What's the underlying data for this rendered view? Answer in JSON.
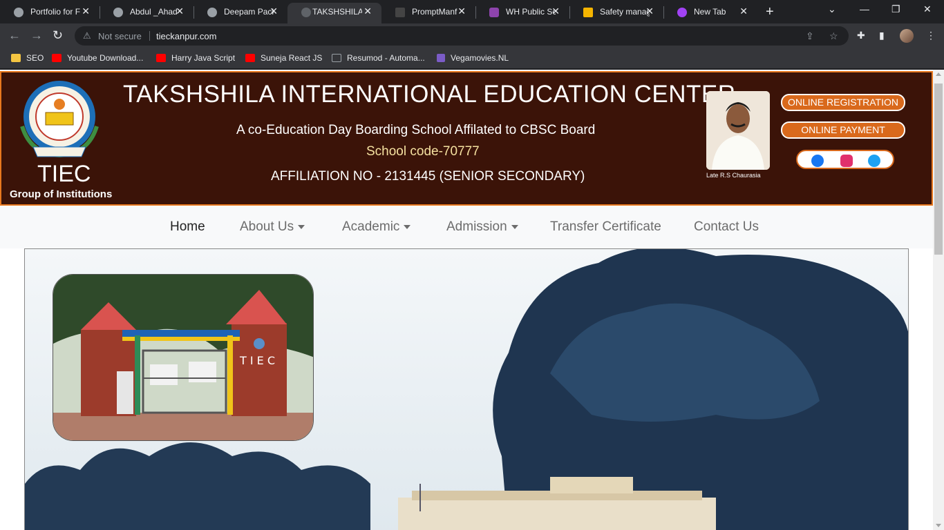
{
  "browser": {
    "tabs": [
      {
        "title": "Portfolio for F",
        "active": false
      },
      {
        "title": "Abdul _Ahad",
        "active": false
      },
      {
        "title": "Deepam Pack",
        "active": false
      },
      {
        "title": "TAKSHSHILA I",
        "active": true
      },
      {
        "title": "PromptManf",
        "active": false
      },
      {
        "title": "WH Public Sc",
        "active": false
      },
      {
        "title": "Safety manag",
        "active": false
      },
      {
        "title": "New Tab",
        "active": false
      }
    ],
    "security_label": "Not secure",
    "url": "tieckanpur.com",
    "bookmarks": [
      {
        "label": "SEO",
        "icon": "folder-icon",
        "color": "#f4c542"
      },
      {
        "label": "Youtube Download...",
        "icon": "youtube-icon",
        "color": "#ff0000"
      },
      {
        "label": "Harry Java Script",
        "icon": "youtube-icon",
        "color": "#ff0000"
      },
      {
        "label": "Suneja React JS",
        "icon": "youtube-icon",
        "color": "#ff0000"
      },
      {
        "label": "Resumod - Automa...",
        "icon": "resumod-icon",
        "color": "#888888"
      },
      {
        "label": "Vegamovies.NL",
        "icon": "vegamovies-icon",
        "color": "#7b5cc7"
      }
    ]
  },
  "header": {
    "logo_text": "TIEC",
    "group_text": "Group of Institutions",
    "title": "TAKSHSHILA INTERNATIONAL EDUCATION CENTER",
    "subtitle": "A co-Education Day Boarding School Affilated to CBSC Board",
    "school_code": "School code-70777",
    "affiliation": "AFFILIATION NO - 2131445 (SENIOR SECONDARY)",
    "portrait_caption": "Late R.S Chaurasia",
    "online_registration": "ONLINE REGISTRATION",
    "online_payment": "ONLINE PAYMENT",
    "social": [
      "facebook-icon",
      "instagram-icon",
      "twitter-icon"
    ]
  },
  "nav": {
    "items": [
      {
        "label": "Home",
        "dropdown": false
      },
      {
        "label": "About Us",
        "dropdown": true
      },
      {
        "label": "Academic",
        "dropdown": true
      },
      {
        "label": "Admission",
        "dropdown": true
      },
      {
        "label": "Transfer Certificate",
        "dropdown": false
      },
      {
        "label": "Contact Us",
        "dropdown": false
      }
    ]
  },
  "hero": {
    "gate_sign": "TIEC"
  },
  "colors": {
    "header_bg": "#3b1308",
    "header_border": "#e8781e",
    "button_bg": "#d9691c"
  }
}
